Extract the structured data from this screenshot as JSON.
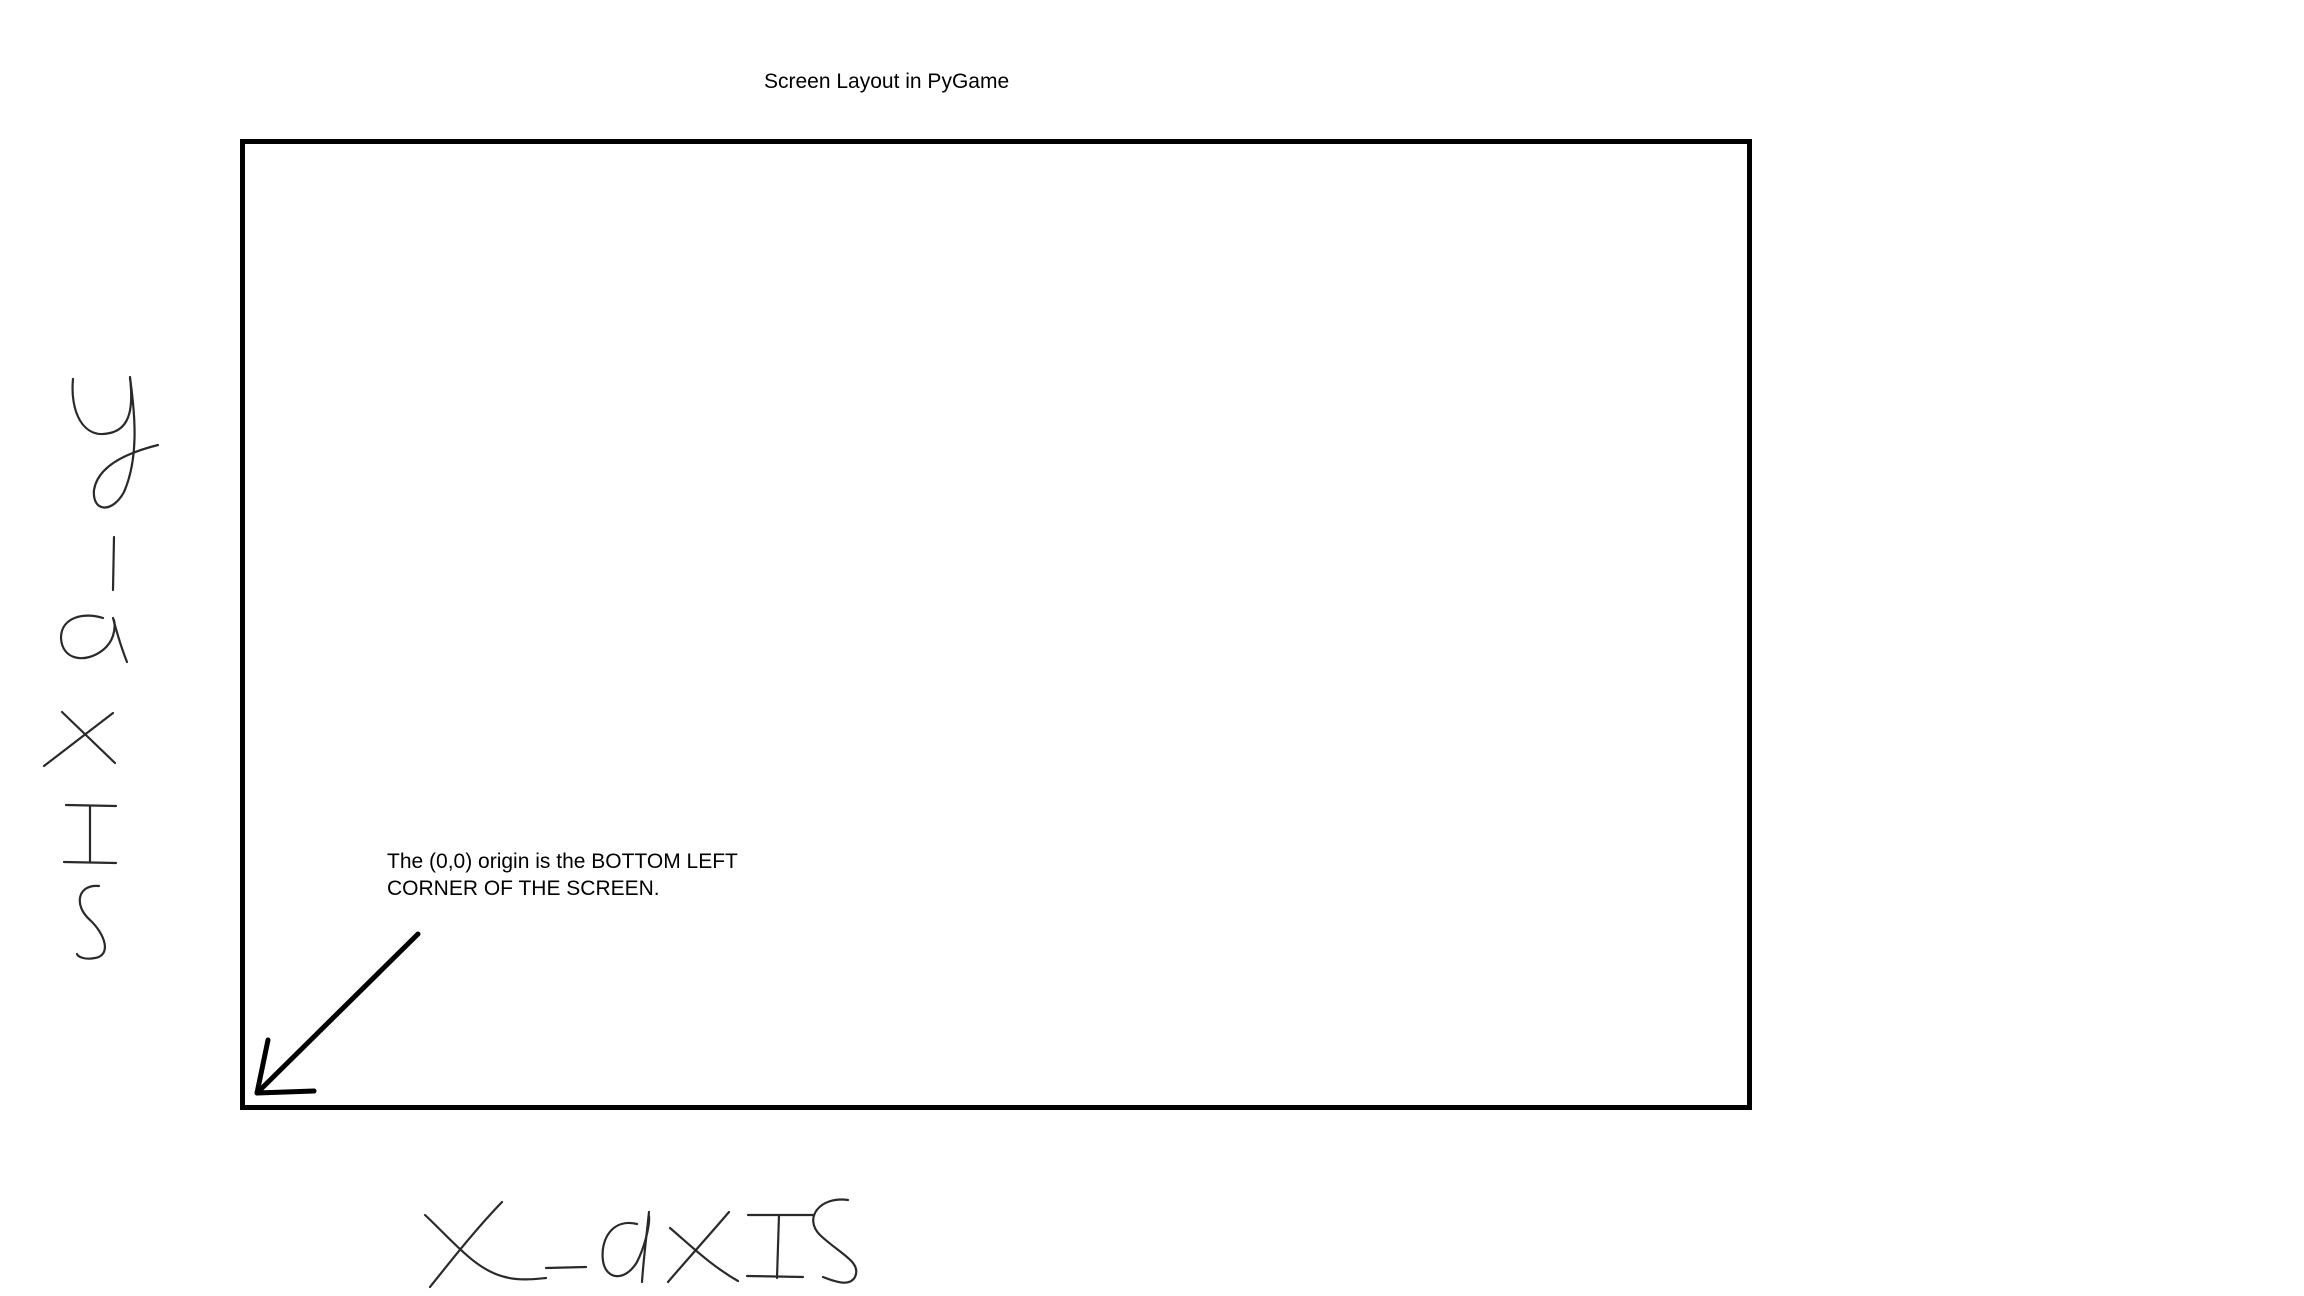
{
  "diagram": {
    "title": "Screen Layout in PyGame",
    "annotation": {
      "line1": "The (0,0) origin is the BOTTOM LEFT",
      "line2": "CORNER OF THE SCREEN."
    },
    "handwritten_labels": {
      "y_axis": "y-axis",
      "x_axis": "x-axis"
    },
    "icons": {
      "arrow": "arrow-down-left-icon"
    }
  }
}
